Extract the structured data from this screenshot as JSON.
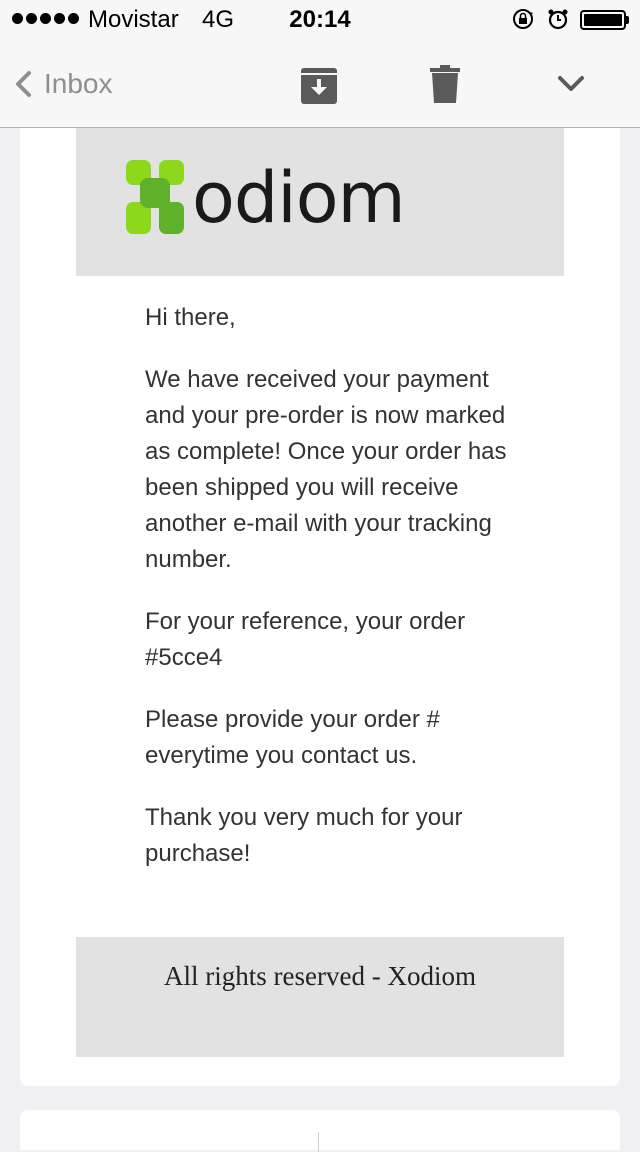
{
  "status_bar": {
    "carrier": "Movistar",
    "network": "4G",
    "time": "20:14",
    "battery_level": 1.0
  },
  "nav": {
    "back_label": "Inbox",
    "icons": [
      "chevron-left-icon",
      "archive-icon",
      "trash-icon",
      "chevron-down-icon"
    ]
  },
  "email": {
    "brand": "odiom",
    "greeting": "Hi there,",
    "paragraph1": "We have received your payment and your pre-order is now marked as complete! Once your order has been shipped you will receive another e-mail with your tracking number.",
    "paragraph2": "For your reference, your order #5cce4",
    "paragraph3": "Please provide your order # everytime you contact us.",
    "paragraph4": "Thank you very much for your purchase!",
    "footer": "All rights reserved - Xodiom"
  },
  "colors": {
    "logo_green_light": "#8ed81c",
    "logo_green_dark": "#5fb12b",
    "banner_gray": "#e2e2e2",
    "background": "#efeff4"
  }
}
